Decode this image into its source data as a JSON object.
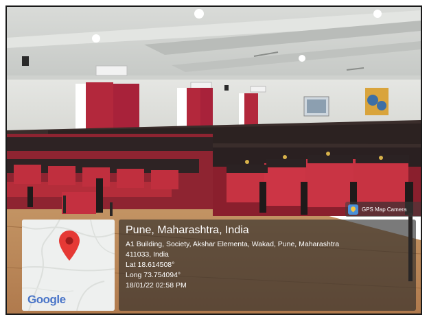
{
  "badge": {
    "label": "GPS Map Camera",
    "icon": "gps-map-camera-icon"
  },
  "map": {
    "brand": "Google",
    "pin_color": "#e53935"
  },
  "info": {
    "city": "Pune, Maharashtra, India",
    "address_line1": "A1 Building, Society, Akshar Elementa, Wakad, Pune, Maharashtra",
    "address_line2": "411033, India",
    "lat": "Lat 18.614508°",
    "long": "Long 73.754094°",
    "datetime": "18/01/22 02:58 PM"
  }
}
